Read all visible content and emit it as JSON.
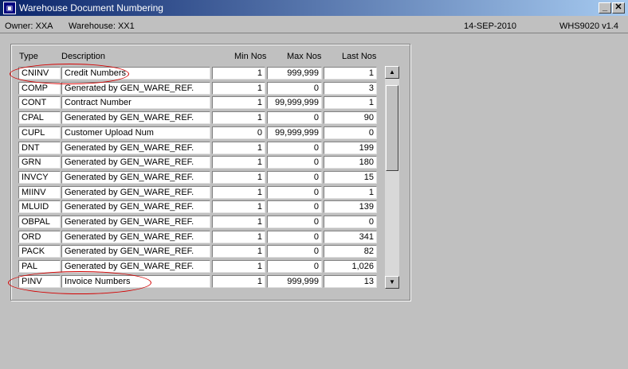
{
  "window": {
    "title": "Warehouse Document Numbering",
    "app_icon": "oracle-forms-icon"
  },
  "header": {
    "owner": "Owner:  XXA",
    "warehouse": "Warehouse:  XX1",
    "date": "14-SEP-2010",
    "version": "WHS9020  v1.4"
  },
  "columns": {
    "type": "Type",
    "description": "Description",
    "min": "Min Nos",
    "max": "Max Nos",
    "last": "Last Nos"
  },
  "rows": [
    {
      "type": "CNINV",
      "desc": "Credit Numbers",
      "min": "1",
      "max": "999,999",
      "last": "1"
    },
    {
      "type": "COMP",
      "desc": "Generated by GEN_WARE_REF.",
      "min": "1",
      "max": "0",
      "last": "3"
    },
    {
      "type": "CONT",
      "desc": "Contract Number",
      "min": "1",
      "max": "99,999,999",
      "last": "1"
    },
    {
      "type": "CPAL",
      "desc": "Generated by GEN_WARE_REF.",
      "min": "1",
      "max": "0",
      "last": "90"
    },
    {
      "type": "CUPL",
      "desc": "Customer Upload Num",
      "min": "0",
      "max": "99,999,999",
      "last": "0"
    },
    {
      "type": "DNT",
      "desc": "Generated by GEN_WARE_REF.",
      "min": "1",
      "max": "0",
      "last": "199"
    },
    {
      "type": "GRN",
      "desc": "Generated by GEN_WARE_REF.",
      "min": "1",
      "max": "0",
      "last": "180"
    },
    {
      "type": "INVCY",
      "desc": "Generated by GEN_WARE_REF.",
      "min": "1",
      "max": "0",
      "last": "15"
    },
    {
      "type": "MIINV",
      "desc": "Generated by GEN_WARE_REF.",
      "min": "1",
      "max": "0",
      "last": "1"
    },
    {
      "type": "MLUID",
      "desc": "Generated by GEN_WARE_REF.",
      "min": "1",
      "max": "0",
      "last": "139"
    },
    {
      "type": "OBPAL",
      "desc": "Generated by GEN_WARE_REF.",
      "min": "1",
      "max": "0",
      "last": "0"
    },
    {
      "type": "ORD",
      "desc": "Generated by GEN_WARE_REF.",
      "min": "1",
      "max": "0",
      "last": "341"
    },
    {
      "type": "PACK",
      "desc": "Generated by GEN_WARE_REF.",
      "min": "1",
      "max": "0",
      "last": "82"
    },
    {
      "type": "PAL",
      "desc": "Generated by GEN_WARE_REF.",
      "min": "1",
      "max": "0",
      "last": "1,026"
    },
    {
      "type": "PINV",
      "desc": "Invoice Numbers",
      "min": "1",
      "max": "999,999",
      "last": "13"
    }
  ],
  "highlight_color": "#d40000"
}
